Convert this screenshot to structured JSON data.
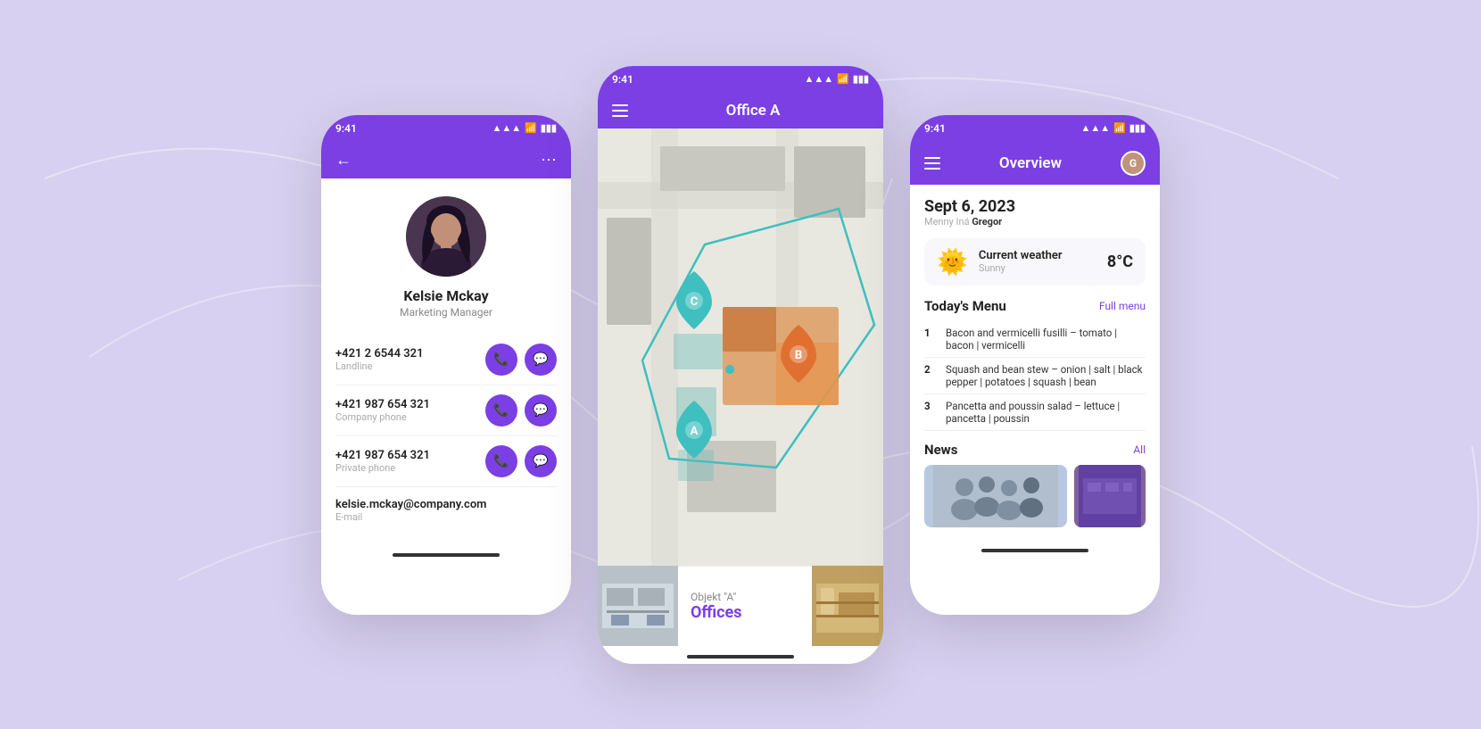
{
  "bg": {
    "color": "#d8d0f0"
  },
  "left_phone": {
    "status_time": "9:41",
    "status_signal": "▲▲▲",
    "status_wifi": "wifi",
    "status_battery": "battery",
    "contact": {
      "name": "Kelsie Mckay",
      "role": "Marketing Manager",
      "phones": [
        {
          "number": "+421 2 6544 321",
          "label": "Landline"
        },
        {
          "number": "+421 987 654 321",
          "label": "Company phone"
        },
        {
          "number": "+421 987 654 321",
          "label": "Private phone"
        }
      ],
      "email": {
        "value": "kelsie.mckay@company.com",
        "label": "E-mail"
      }
    }
  },
  "center_phone": {
    "status_time": "9:41",
    "app_bar_title": "Office A",
    "map_object_label": "Objekt \"A\"",
    "map_object_type": "Offices",
    "pins": [
      {
        "id": "A",
        "color": "teal"
      },
      {
        "id": "B",
        "color": "orange"
      },
      {
        "id": "C",
        "color": "teal"
      }
    ]
  },
  "right_phone": {
    "status_time": "9:41",
    "app_bar_title": "Overview",
    "date": "Sept 6, 2023",
    "greeting_prefix": "Menny Iná",
    "greeting_name": "Gregor",
    "weather": {
      "label": "Current weather",
      "condition": "Sunny",
      "temp": "8°C"
    },
    "menu_section_title": "Today's Menu",
    "menu_link": "Full menu",
    "menu_items": [
      {
        "num": "1",
        "text": "Bacon and vermicelli fusilli – tomato | bacon | vermicelli"
      },
      {
        "num": "2",
        "text": "Squash and bean stew – onion | salt | black pepper | potatoes | squash | bean"
      },
      {
        "num": "3",
        "text": "Pancetta and poussin salad – lettuce | pancetta | poussin"
      }
    ],
    "news_section_title": "News",
    "news_link": "All"
  }
}
